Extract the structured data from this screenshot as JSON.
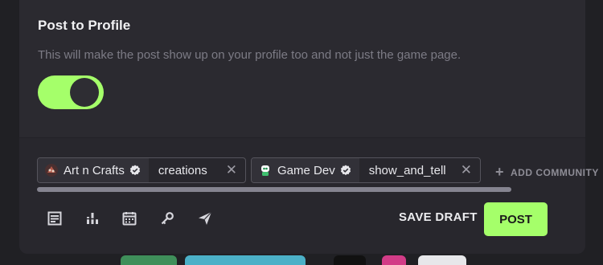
{
  "post_to_profile": {
    "title": "Post to Profile",
    "description": "This will make the post show up on your profile too and not just the game page.",
    "enabled": true
  },
  "tags": [
    {
      "game": "Art n Crafts",
      "channel": "creations",
      "verified": true,
      "icon": "palette-icon"
    },
    {
      "game": "Game Dev",
      "channel": "show_and_tell",
      "verified": true,
      "icon": "robot-icon"
    }
  ],
  "add_community_label": "ADD COMMUNITY",
  "toolbar": {
    "tools": [
      "article-icon",
      "poll-icon",
      "calendar-icon",
      "key-icon",
      "send-icon"
    ],
    "save_draft_label": "SAVE DRAFT",
    "post_label": "POST"
  },
  "colors": {
    "accent": "#a5ff6a",
    "modal_bg": "#28272d"
  }
}
